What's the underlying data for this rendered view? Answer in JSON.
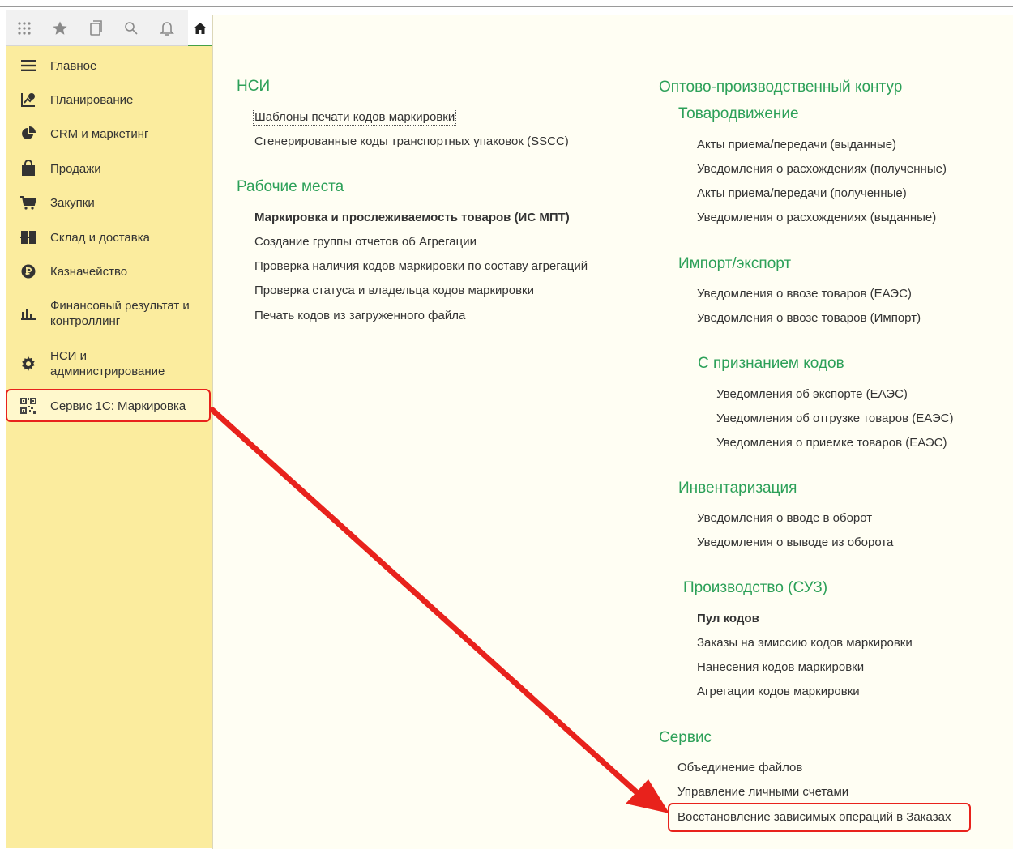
{
  "toolbar": {
    "icons": [
      "apps-grid-icon",
      "star-icon",
      "history-icon",
      "search-icon",
      "bell-icon",
      "home-icon"
    ]
  },
  "sidebar": {
    "items": [
      {
        "label": "Главное",
        "icon": "menu-lines-icon"
      },
      {
        "label": "Планирование",
        "icon": "planning-chart-icon"
      },
      {
        "label": "CRM и маркетинг",
        "icon": "pie-chart-icon"
      },
      {
        "label": "Продажи",
        "icon": "shopping-bag-icon"
      },
      {
        "label": "Закупки",
        "icon": "cart-icon"
      },
      {
        "label": "Склад и доставка",
        "icon": "warehouse-icon"
      },
      {
        "label": "Казначейство",
        "icon": "ruble-coin-icon"
      },
      {
        "label": "Финансовый результат и контроллинг",
        "icon": "bar-chart-icon"
      },
      {
        "label": "НСИ и администрирование",
        "icon": "gear-icon"
      },
      {
        "label": "Сервис 1С: Маркировка",
        "icon": "qr-code-icon"
      }
    ]
  },
  "main": {
    "nsi": {
      "title": "НСИ",
      "links": [
        "Шаблоны печати кодов маркировки",
        "Сгенерированные коды транспортных упаковок (SSCC)"
      ]
    },
    "workplaces": {
      "title": "Рабочие места",
      "links": [
        "Маркировка и прослеживаемость товаров (ИС МПТ)",
        "Создание группы отчетов об Агрегации",
        "Проверка наличия кодов маркировки по составу агрегаций",
        "Проверка статуса и владельца кодов маркировки",
        "Печать кодов из загруженного файла"
      ]
    },
    "wholesale": {
      "title": "Оптово-производственный контур",
      "movement": {
        "title": "Товародвижение",
        "links": [
          "Акты приема/передачи (выданные)",
          "Уведомления о расхождениях (полученные)",
          "Акты приема/передачи (полученные)",
          "Уведомления о расхождениях (выданные)"
        ]
      },
      "import_export": {
        "title": "Импорт/экспорт",
        "links": [
          "Уведомления о ввозе товаров (ЕАЭС)",
          "Уведомления о ввозе товаров (Импорт)"
        ]
      },
      "with_codes": {
        "title": "С признанием кодов",
        "links": [
          "Уведомления об экспорте (ЕАЭС)",
          "Уведомления об отгрузке товаров (ЕАЭС)",
          "Уведомления о приемке товаров (ЕАЭС)"
        ]
      },
      "inventory": {
        "title": "Инвентаризация",
        "links": [
          "Уведомления о вводе в оборот",
          "Уведомления о выводе из оборота"
        ]
      },
      "production": {
        "title": "Производство (СУЗ)",
        "links": [
          "Пул кодов",
          "Заказы на эмиссию кодов маркировки",
          "Нанесения кодов маркировки",
          "Агрегации кодов маркировки"
        ]
      }
    },
    "service": {
      "title": "Сервис",
      "links": [
        "Объединение файлов",
        "Управление личными счетами",
        "Восстановление зависимых операций в Заказах"
      ]
    }
  },
  "colors": {
    "sidebar_bg": "#fbec9e",
    "section_green": "#2ca058",
    "highlight_red": "#e8221c",
    "panel_bg": "#fffef3"
  }
}
